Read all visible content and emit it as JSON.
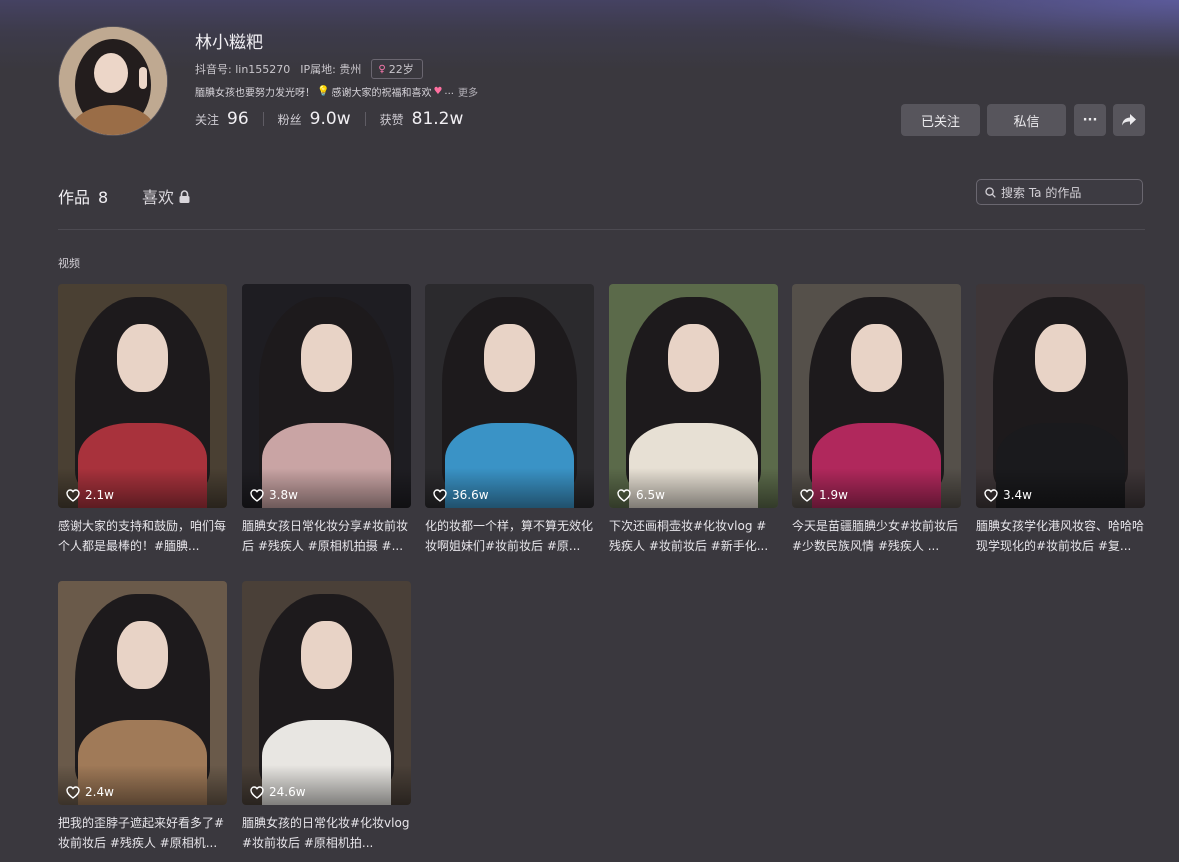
{
  "profile": {
    "name": "林小糍粑",
    "douyin_id": "抖音号: lin155270",
    "ip": "IP属地: 贵州",
    "age_tag": "22岁",
    "bio": "腼腆女孩也要努力发光呀！",
    "bio2": "感谢大家的祝福和喜欢",
    "bio_more_dots": "...",
    "bio_more": "更多",
    "following_label": "关注",
    "following": "96",
    "fans_label": "粉丝",
    "fans": "9.0w",
    "likes_label": "获赞",
    "likes": "81.2w"
  },
  "actions": {
    "followed": "已关注",
    "message": "私信",
    "more": "···",
    "share_icon": "share-icon"
  },
  "tabs": {
    "works_label": "作品",
    "works_count": "8",
    "likes_label": "喜欢",
    "likes_icon": "lock-icon"
  },
  "search": {
    "placeholder": "搜索 Ta 的作品"
  },
  "section_label": "视频",
  "colors": {
    "background": "#3a383e",
    "button": "#57555c"
  },
  "videos": [
    {
      "likes": "2.1w",
      "caption": "感谢大家的支持和鼓励，咱们每个人都是最棒的！#腼腆...",
      "bg": "#4a4033",
      "outfit": "#a8323c"
    },
    {
      "likes": "3.8w",
      "caption": "腼腆女孩日常化妆分享#妆前妆后 #残疾人 #原相机拍摄 #...",
      "bg": "#1e1d22",
      "outfit": "#c9a4a4"
    },
    {
      "likes": "36.6w",
      "caption": "化的妆都一个样，算不算无效化妆啊姐妹们#妆前妆后 #原...",
      "bg": "#2b2a2d",
      "outfit": "#3a93c6"
    },
    {
      "likes": "6.5w",
      "caption": "下次还画桐壶妆#化妆vlog #残疾人 #妆前妆后 #新手化...",
      "bg": "#5b6a4a",
      "outfit": "#e7e0d4"
    },
    {
      "likes": "1.9w",
      "caption": "今天是苗疆腼腆少女#妆前妆后 #少数民族风情 #残疾人 ...",
      "bg": "#55504a",
      "outfit": "#b0285c"
    },
    {
      "likes": "3.4w",
      "caption": "腼腆女孩学化港风妆容、哈哈哈现学现化的#妆前妆后 #复...",
      "bg": "#3e3638",
      "outfit": "#1a1a1d"
    },
    {
      "likes": "2.4w",
      "caption": "把我的歪脖子遮起来好看多了#妆前妆后 #残疾人 #原相机...",
      "bg": "#6a5a4a",
      "outfit": "#a07a58"
    },
    {
      "likes": "24.6w",
      "caption": "腼腆女孩的日常化妆#化妆vlog #妆前妆后 #原相机拍...",
      "bg": "#4a4038",
      "outfit": "#e8e6e2"
    }
  ]
}
